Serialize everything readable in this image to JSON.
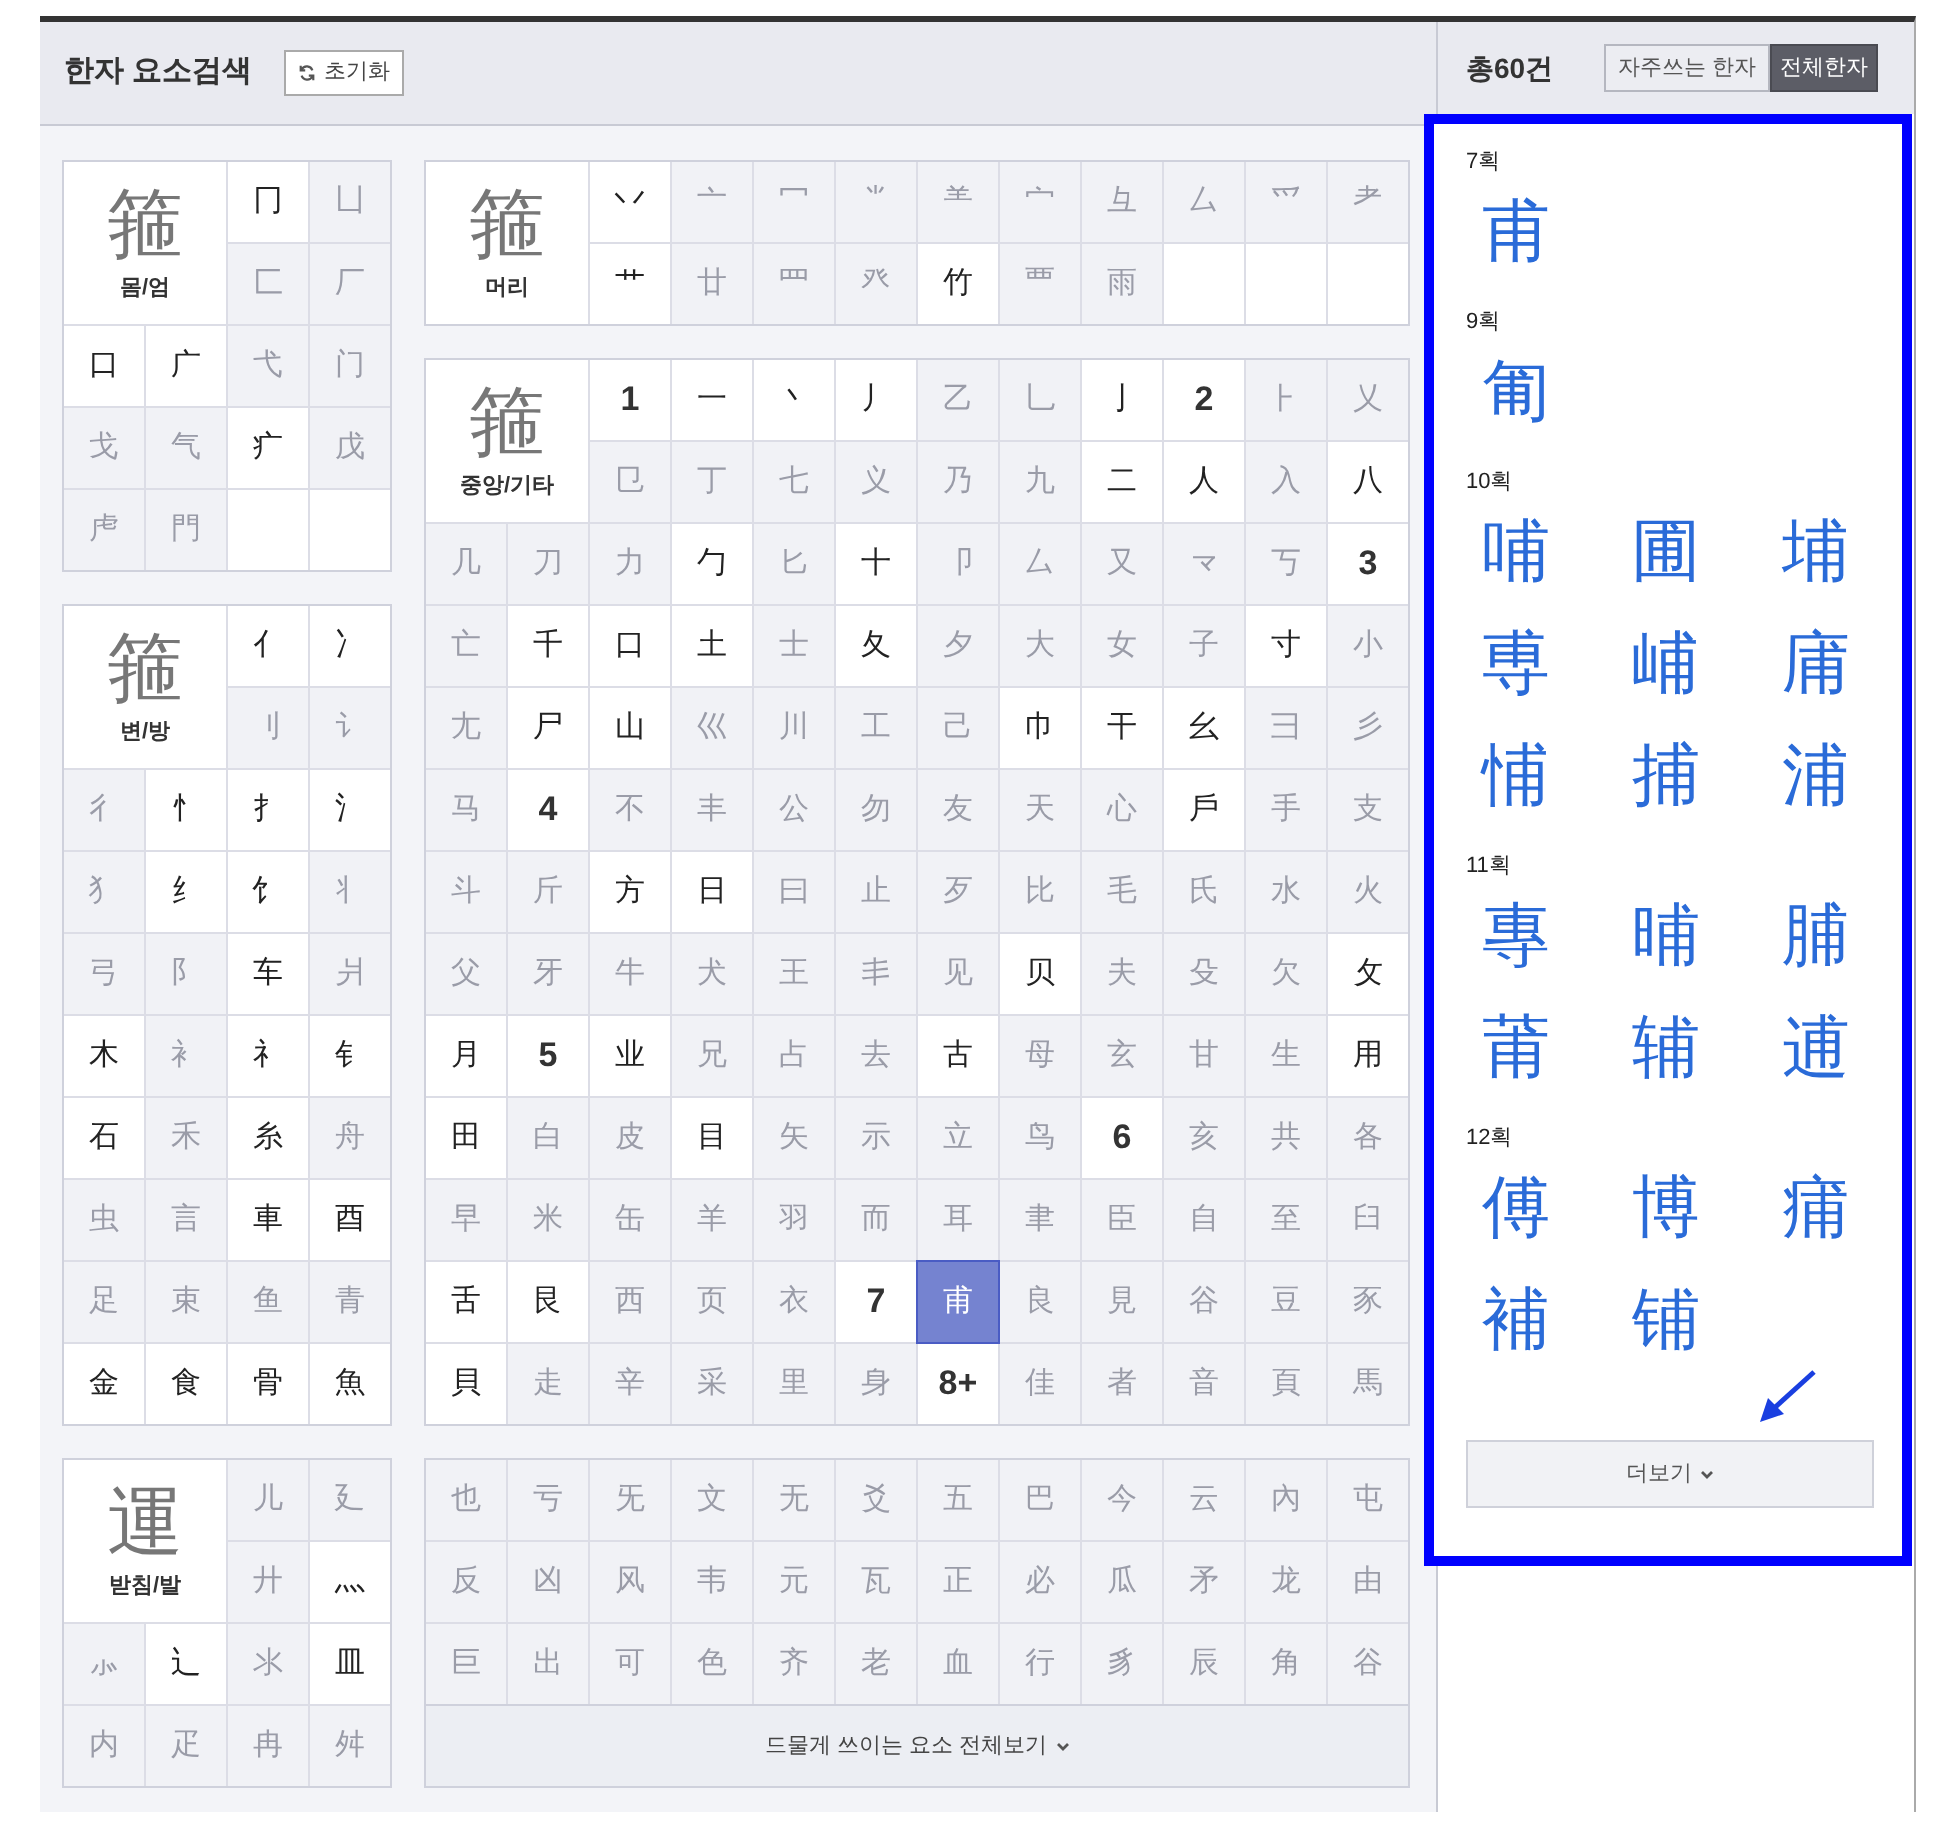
{
  "search_header": {
    "title": "한자 요소검색",
    "reset_button": "초기화"
  },
  "left_panels": [
    {
      "label": "몸/엄",
      "example": "箍",
      "cells": [
        {
          "kind": "element",
          "char": "冂",
          "enabled": true,
          "selected": false
        },
        {
          "kind": "element",
          "char": "凵",
          "enabled": false,
          "selected": false
        },
        {
          "kind": "element",
          "char": "匚",
          "enabled": false,
          "selected": false
        },
        {
          "kind": "element",
          "char": "厂",
          "enabled": false,
          "selected": false
        },
        {
          "kind": "element",
          "char": "口",
          "enabled": true,
          "selected": false
        },
        {
          "kind": "element",
          "char": "广",
          "enabled": true,
          "selected": false
        },
        {
          "kind": "element",
          "char": "弋",
          "enabled": false,
          "selected": false
        },
        {
          "kind": "element",
          "char": "门",
          "enabled": false,
          "selected": false
        },
        {
          "kind": "element",
          "char": "戈",
          "enabled": false,
          "selected": false
        },
        {
          "kind": "element",
          "char": "气",
          "enabled": false,
          "selected": false
        },
        {
          "kind": "element",
          "char": "疒",
          "enabled": true,
          "selected": false
        },
        {
          "kind": "element",
          "char": "戊",
          "enabled": false,
          "selected": false
        },
        {
          "kind": "element",
          "char": "虍",
          "enabled": false,
          "selected": false
        },
        {
          "kind": "element",
          "char": "門",
          "enabled": false,
          "selected": false
        }
      ]
    },
    {
      "label": "변/방",
      "example": "箍",
      "cells": [
        {
          "kind": "element",
          "char": "亻",
          "enabled": true,
          "selected": false
        },
        {
          "kind": "element",
          "char": "冫",
          "enabled": true,
          "selected": false
        },
        {
          "kind": "element",
          "char": "刂",
          "enabled": false,
          "selected": false
        },
        {
          "kind": "element",
          "char": "讠",
          "enabled": false,
          "selected": false
        },
        {
          "kind": "element",
          "char": "彳",
          "enabled": false,
          "selected": false
        },
        {
          "kind": "element",
          "char": "忄",
          "enabled": true,
          "selected": false
        },
        {
          "kind": "element",
          "char": "扌",
          "enabled": true,
          "selected": false
        },
        {
          "kind": "element",
          "char": "氵",
          "enabled": true,
          "selected": false
        },
        {
          "kind": "element",
          "char": "犭",
          "enabled": false,
          "selected": false
        },
        {
          "kind": "element",
          "char": "纟",
          "enabled": true,
          "selected": false
        },
        {
          "kind": "element",
          "char": "饣",
          "enabled": true,
          "selected": false
        },
        {
          "kind": "element",
          "char": "丬",
          "enabled": false,
          "selected": false
        },
        {
          "kind": "element",
          "char": "弓",
          "enabled": false,
          "selected": false
        },
        {
          "kind": "element",
          "char": "阝",
          "enabled": false,
          "selected": false
        },
        {
          "kind": "element",
          "char": "车",
          "enabled": true,
          "selected": false
        },
        {
          "kind": "element",
          "char": "爿",
          "enabled": false,
          "selected": false
        },
        {
          "kind": "element",
          "char": "木",
          "enabled": true,
          "selected": false
        },
        {
          "kind": "element",
          "char": "衤",
          "enabled": false,
          "selected": false
        },
        {
          "kind": "element",
          "char": "礻",
          "enabled": true,
          "selected": false
        },
        {
          "kind": "element",
          "char": "钅",
          "enabled": true,
          "selected": false
        },
        {
          "kind": "element",
          "char": "石",
          "enabled": true,
          "selected": false
        },
        {
          "kind": "element",
          "char": "禾",
          "enabled": false,
          "selected": false
        },
        {
          "kind": "element",
          "char": "糸",
          "enabled": true,
          "selected": false
        },
        {
          "kind": "element",
          "char": "舟",
          "enabled": false,
          "selected": false
        },
        {
          "kind": "element",
          "char": "虫",
          "enabled": false,
          "selected": false
        },
        {
          "kind": "element",
          "char": "言",
          "enabled": false,
          "selected": false
        },
        {
          "kind": "element",
          "char": "車",
          "enabled": true,
          "selected": false
        },
        {
          "kind": "element",
          "char": "酉",
          "enabled": true,
          "selected": false
        },
        {
          "kind": "element",
          "char": "足",
          "enabled": false,
          "selected": false
        },
        {
          "kind": "element",
          "char": "束",
          "enabled": false,
          "selected": false
        },
        {
          "kind": "element",
          "char": "鱼",
          "enabled": false,
          "selected": false
        },
        {
          "kind": "element",
          "char": "青",
          "enabled": false,
          "selected": false
        },
        {
          "kind": "element",
          "char": "金",
          "enabled": true,
          "selected": false
        },
        {
          "kind": "element",
          "char": "食",
          "enabled": true,
          "selected": false
        },
        {
          "kind": "element",
          "char": "骨",
          "enabled": true,
          "selected": false
        },
        {
          "kind": "element",
          "char": "魚",
          "enabled": true,
          "selected": false
        }
      ]
    },
    {
      "label": "받침/발",
      "example": "運",
      "cells": [
        {
          "kind": "element",
          "char": "儿",
          "enabled": false,
          "selected": false
        },
        {
          "kind": "element",
          "char": "廴",
          "enabled": false,
          "selected": false
        },
        {
          "kind": "element",
          "char": "廾",
          "enabled": false,
          "selected": false
        },
        {
          "kind": "element",
          "char": "灬",
          "enabled": true,
          "selected": false
        },
        {
          "kind": "element",
          "char": "⺗",
          "enabled": false,
          "selected": false
        },
        {
          "kind": "element",
          "char": "辶",
          "enabled": true,
          "selected": false
        },
        {
          "kind": "element",
          "char": "氺",
          "enabled": false,
          "selected": false
        },
        {
          "kind": "element",
          "char": "皿",
          "enabled": true,
          "selected": false
        },
        {
          "kind": "element",
          "char": "内",
          "enabled": false,
          "selected": false
        },
        {
          "kind": "element",
          "char": "疋",
          "enabled": false,
          "selected": false
        },
        {
          "kind": "element",
          "char": "冉",
          "enabled": false,
          "selected": false
        },
        {
          "kind": "element",
          "char": "舛",
          "enabled": false,
          "selected": false
        }
      ]
    }
  ],
  "middle_panels": [
    {
      "label": "머리",
      "example": "箍",
      "cells": [
        {
          "kind": "element",
          "char": "丷",
          "enabled": true,
          "selected": false
        },
        {
          "kind": "element",
          "char": "亠",
          "enabled": false,
          "selected": false
        },
        {
          "kind": "element",
          "char": "冖",
          "enabled": false,
          "selected": false
        },
        {
          "kind": "element",
          "char": "⺌",
          "enabled": false,
          "selected": false
        },
        {
          "kind": "element",
          "char": "⺷",
          "enabled": false,
          "selected": false
        },
        {
          "kind": "element",
          "char": "宀",
          "enabled": false,
          "selected": false
        },
        {
          "kind": "element",
          "char": "彑",
          "enabled": false,
          "selected": false
        },
        {
          "kind": "element",
          "char": "厶",
          "enabled": false,
          "selected": false
        },
        {
          "kind": "element",
          "char": "爫",
          "enabled": false,
          "selected": false
        },
        {
          "kind": "element",
          "char": "耂",
          "enabled": false,
          "selected": false
        },
        {
          "kind": "element",
          "char": "艹",
          "enabled": true,
          "selected": false
        },
        {
          "kind": "element",
          "char": "廿",
          "enabled": false,
          "selected": false
        },
        {
          "kind": "element",
          "char": "罒",
          "enabled": false,
          "selected": false
        },
        {
          "kind": "element",
          "char": "癶",
          "enabled": false,
          "selected": false
        },
        {
          "kind": "element",
          "char": "竹",
          "enabled": true,
          "selected": false
        },
        {
          "kind": "element",
          "char": "覀",
          "enabled": false,
          "selected": false
        },
        {
          "kind": "element",
          "char": "雨",
          "enabled": false,
          "selected": false
        }
      ]
    },
    {
      "label": "중앙/기타",
      "example": "箍",
      "cells": [
        {
          "kind": "stroke",
          "char": "1"
        },
        {
          "kind": "element",
          "char": "一",
          "enabled": true,
          "selected": false
        },
        {
          "kind": "element",
          "char": "丶",
          "enabled": true,
          "selected": false
        },
        {
          "kind": "element",
          "char": "丿",
          "enabled": true,
          "selected": false
        },
        {
          "kind": "element",
          "char": "乙",
          "enabled": false,
          "selected": false
        },
        {
          "kind": "element",
          "char": "乚",
          "enabled": false,
          "selected": false
        },
        {
          "kind": "element",
          "char": "亅",
          "enabled": true,
          "selected": false
        },
        {
          "kind": "stroke",
          "char": "2"
        },
        {
          "kind": "element",
          "char": "⺊",
          "enabled": false,
          "selected": false
        },
        {
          "kind": "element",
          "char": "乂",
          "enabled": false,
          "selected": false
        },
        {
          "kind": "element",
          "char": "㔾",
          "enabled": false,
          "selected": false
        },
        {
          "kind": "element",
          "char": "丁",
          "enabled": false,
          "selected": false
        },
        {
          "kind": "element",
          "char": "七",
          "enabled": false,
          "selected": false
        },
        {
          "kind": "element",
          "char": "义",
          "enabled": false,
          "selected": false
        },
        {
          "kind": "element",
          "char": "乃",
          "enabled": false,
          "selected": false
        },
        {
          "kind": "element",
          "char": "九",
          "enabled": false,
          "selected": false
        },
        {
          "kind": "element",
          "char": "二",
          "enabled": true,
          "selected": false
        },
        {
          "kind": "element",
          "char": "人",
          "enabled": true,
          "selected": false
        },
        {
          "kind": "element",
          "char": "入",
          "enabled": false,
          "selected": false
        },
        {
          "kind": "element",
          "char": "八",
          "enabled": true,
          "selected": false
        },
        {
          "kind": "element",
          "char": "几",
          "enabled": false,
          "selected": false
        },
        {
          "kind": "element",
          "char": "刀",
          "enabled": false,
          "selected": false
        },
        {
          "kind": "element",
          "char": "力",
          "enabled": false,
          "selected": false
        },
        {
          "kind": "element",
          "char": "勹",
          "enabled": true,
          "selected": false
        },
        {
          "kind": "element",
          "char": "匕",
          "enabled": false,
          "selected": false
        },
        {
          "kind": "element",
          "char": "十",
          "enabled": true,
          "selected": false
        },
        {
          "kind": "element",
          "char": "卩",
          "enabled": false,
          "selected": false
        },
        {
          "kind": "element",
          "char": "厶",
          "enabled": false,
          "selected": false
        },
        {
          "kind": "element",
          "char": "又",
          "enabled": false,
          "selected": false
        },
        {
          "kind": "element",
          "char": "龴",
          "enabled": false,
          "selected": false
        },
        {
          "kind": "element",
          "char": "丂",
          "enabled": false,
          "selected": false
        },
        {
          "kind": "stroke",
          "char": "3"
        },
        {
          "kind": "element",
          "char": "亡",
          "enabled": false,
          "selected": false
        },
        {
          "kind": "element",
          "char": "千",
          "enabled": true,
          "selected": false
        },
        {
          "kind": "element",
          "char": "口",
          "enabled": true,
          "selected": false
        },
        {
          "kind": "element",
          "char": "土",
          "enabled": true,
          "selected": false
        },
        {
          "kind": "element",
          "char": "士",
          "enabled": false,
          "selected": false
        },
        {
          "kind": "element",
          "char": "夂",
          "enabled": true,
          "selected": false
        },
        {
          "kind": "element",
          "char": "夕",
          "enabled": false,
          "selected": false
        },
        {
          "kind": "element",
          "char": "大",
          "enabled": false,
          "selected": false
        },
        {
          "kind": "element",
          "char": "女",
          "enabled": false,
          "selected": false
        },
        {
          "kind": "element",
          "char": "子",
          "enabled": false,
          "selected": false
        },
        {
          "kind": "element",
          "char": "寸",
          "enabled": true,
          "selected": false
        },
        {
          "kind": "element",
          "char": "小",
          "enabled": false,
          "selected": false
        },
        {
          "kind": "element",
          "char": "尢",
          "enabled": false,
          "selected": false
        },
        {
          "kind": "element",
          "char": "尸",
          "enabled": true,
          "selected": false
        },
        {
          "kind": "element",
          "char": "山",
          "enabled": true,
          "selected": false
        },
        {
          "kind": "element",
          "char": "巛",
          "enabled": false,
          "selected": false
        },
        {
          "kind": "element",
          "char": "川",
          "enabled": false,
          "selected": false
        },
        {
          "kind": "element",
          "char": "工",
          "enabled": false,
          "selected": false
        },
        {
          "kind": "element",
          "char": "己",
          "enabled": false,
          "selected": false
        },
        {
          "kind": "element",
          "char": "巾",
          "enabled": true,
          "selected": false
        },
        {
          "kind": "element",
          "char": "干",
          "enabled": true,
          "selected": false
        },
        {
          "kind": "element",
          "char": "幺",
          "enabled": true,
          "selected": false
        },
        {
          "kind": "element",
          "char": "彐",
          "enabled": false,
          "selected": false
        },
        {
          "kind": "element",
          "char": "彡",
          "enabled": false,
          "selected": false
        },
        {
          "kind": "element",
          "char": "马",
          "enabled": false,
          "selected": false
        },
        {
          "kind": "stroke",
          "char": "4"
        },
        {
          "kind": "element",
          "char": "不",
          "enabled": false,
          "selected": false
        },
        {
          "kind": "element",
          "char": "丰",
          "enabled": false,
          "selected": false
        },
        {
          "kind": "element",
          "char": "公",
          "enabled": false,
          "selected": false
        },
        {
          "kind": "element",
          "char": "勿",
          "enabled": false,
          "selected": false
        },
        {
          "kind": "element",
          "char": "友",
          "enabled": false,
          "selected": false
        },
        {
          "kind": "element",
          "char": "天",
          "enabled": false,
          "selected": false
        },
        {
          "kind": "element",
          "char": "心",
          "enabled": false,
          "selected": false
        },
        {
          "kind": "element",
          "char": "戶",
          "enabled": true,
          "selected": false
        },
        {
          "kind": "element",
          "char": "手",
          "enabled": false,
          "selected": false
        },
        {
          "kind": "element",
          "char": "支",
          "enabled": false,
          "selected": false
        },
        {
          "kind": "element",
          "char": "斗",
          "enabled": false,
          "selected": false
        },
        {
          "kind": "element",
          "char": "斤",
          "enabled": false,
          "selected": false
        },
        {
          "kind": "element",
          "char": "方",
          "enabled": true,
          "selected": false
        },
        {
          "kind": "element",
          "char": "日",
          "enabled": true,
          "selected": false
        },
        {
          "kind": "element",
          "char": "曰",
          "enabled": false,
          "selected": false
        },
        {
          "kind": "element",
          "char": "止",
          "enabled": false,
          "selected": false
        },
        {
          "kind": "element",
          "char": "歹",
          "enabled": false,
          "selected": false
        },
        {
          "kind": "element",
          "char": "比",
          "enabled": false,
          "selected": false
        },
        {
          "kind": "element",
          "char": "毛",
          "enabled": false,
          "selected": false
        },
        {
          "kind": "element",
          "char": "氏",
          "enabled": false,
          "selected": false
        },
        {
          "kind": "element",
          "char": "水",
          "enabled": false,
          "selected": false
        },
        {
          "kind": "element",
          "char": "火",
          "enabled": false,
          "selected": false
        },
        {
          "kind": "element",
          "char": "父",
          "enabled": false,
          "selected": false
        },
        {
          "kind": "element",
          "char": "牙",
          "enabled": false,
          "selected": false
        },
        {
          "kind": "element",
          "char": "牛",
          "enabled": false,
          "selected": false
        },
        {
          "kind": "element",
          "char": "犬",
          "enabled": false,
          "selected": false
        },
        {
          "kind": "element",
          "char": "王",
          "enabled": false,
          "selected": false
        },
        {
          "kind": "element",
          "char": "丯",
          "enabled": false,
          "selected": false
        },
        {
          "kind": "element",
          "char": "见",
          "enabled": false,
          "selected": false
        },
        {
          "kind": "element",
          "char": "贝",
          "enabled": true,
          "selected": false
        },
        {
          "kind": "element",
          "char": "夫",
          "enabled": false,
          "selected": false
        },
        {
          "kind": "element",
          "char": "殳",
          "enabled": false,
          "selected": false
        },
        {
          "kind": "element",
          "char": "欠",
          "enabled": false,
          "selected": false
        },
        {
          "kind": "element",
          "char": "攵",
          "enabled": true,
          "selected": false
        },
        {
          "kind": "element",
          "char": "月",
          "enabled": true,
          "selected": false
        },
        {
          "kind": "stroke",
          "char": "5"
        },
        {
          "kind": "element",
          "char": "业",
          "enabled": true,
          "selected": false
        },
        {
          "kind": "element",
          "char": "兄",
          "enabled": false,
          "selected": false
        },
        {
          "kind": "element",
          "char": "占",
          "enabled": false,
          "selected": false
        },
        {
          "kind": "element",
          "char": "去",
          "enabled": false,
          "selected": false
        },
        {
          "kind": "element",
          "char": "古",
          "enabled": true,
          "selected": false
        },
        {
          "kind": "element",
          "char": "母",
          "enabled": false,
          "selected": false
        },
        {
          "kind": "element",
          "char": "玄",
          "enabled": false,
          "selected": false
        },
        {
          "kind": "element",
          "char": "甘",
          "enabled": false,
          "selected": false
        },
        {
          "kind": "element",
          "char": "生",
          "enabled": false,
          "selected": false
        },
        {
          "kind": "element",
          "char": "用",
          "enabled": true,
          "selected": false
        },
        {
          "kind": "element",
          "char": "田",
          "enabled": true,
          "selected": false
        },
        {
          "kind": "element",
          "char": "白",
          "enabled": false,
          "selected": false
        },
        {
          "kind": "element",
          "char": "皮",
          "enabled": false,
          "selected": false
        },
        {
          "kind": "element",
          "char": "目",
          "enabled": true,
          "selected": false
        },
        {
          "kind": "element",
          "char": "矢",
          "enabled": false,
          "selected": false
        },
        {
          "kind": "element",
          "char": "示",
          "enabled": false,
          "selected": false
        },
        {
          "kind": "element",
          "char": "立",
          "enabled": false,
          "selected": false
        },
        {
          "kind": "element",
          "char": "鸟",
          "enabled": false,
          "selected": false
        },
        {
          "kind": "stroke",
          "char": "6"
        },
        {
          "kind": "element",
          "char": "亥",
          "enabled": false,
          "selected": false
        },
        {
          "kind": "element",
          "char": "共",
          "enabled": false,
          "selected": false
        },
        {
          "kind": "element",
          "char": "各",
          "enabled": false,
          "selected": false
        },
        {
          "kind": "element",
          "char": "早",
          "enabled": false,
          "selected": false
        },
        {
          "kind": "element",
          "char": "米",
          "enabled": false,
          "selected": false
        },
        {
          "kind": "element",
          "char": "缶",
          "enabled": false,
          "selected": false
        },
        {
          "kind": "element",
          "char": "羊",
          "enabled": false,
          "selected": false
        },
        {
          "kind": "element",
          "char": "羽",
          "enabled": false,
          "selected": false
        },
        {
          "kind": "element",
          "char": "而",
          "enabled": false,
          "selected": false
        },
        {
          "kind": "element",
          "char": "耳",
          "enabled": false,
          "selected": false
        },
        {
          "kind": "element",
          "char": "聿",
          "enabled": false,
          "selected": false
        },
        {
          "kind": "element",
          "char": "臣",
          "enabled": false,
          "selected": false
        },
        {
          "kind": "element",
          "char": "自",
          "enabled": false,
          "selected": false
        },
        {
          "kind": "element",
          "char": "至",
          "enabled": false,
          "selected": false
        },
        {
          "kind": "element",
          "char": "臼",
          "enabled": false,
          "selected": false
        },
        {
          "kind": "element",
          "char": "舌",
          "enabled": true,
          "selected": false
        },
        {
          "kind": "element",
          "char": "艮",
          "enabled": true,
          "selected": false
        },
        {
          "kind": "element",
          "char": "西",
          "enabled": false,
          "selected": false
        },
        {
          "kind": "element",
          "char": "页",
          "enabled": false,
          "selected": false
        },
        {
          "kind": "element",
          "char": "衣",
          "enabled": false,
          "selected": false
        },
        {
          "kind": "stroke",
          "char": "7"
        },
        {
          "kind": "element",
          "char": "甫",
          "enabled": true,
          "selected": true
        },
        {
          "kind": "element",
          "char": "良",
          "enabled": false,
          "selected": false
        },
        {
          "kind": "element",
          "char": "見",
          "enabled": false,
          "selected": false
        },
        {
          "kind": "element",
          "char": "谷",
          "enabled": false,
          "selected": false
        },
        {
          "kind": "element",
          "char": "豆",
          "enabled": false,
          "selected": false
        },
        {
          "kind": "element",
          "char": "豕",
          "enabled": false,
          "selected": false
        },
        {
          "kind": "element",
          "char": "貝",
          "enabled": true,
          "selected": false
        },
        {
          "kind": "element",
          "char": "走",
          "enabled": false,
          "selected": false
        },
        {
          "kind": "element",
          "char": "辛",
          "enabled": false,
          "selected": false
        },
        {
          "kind": "element",
          "char": "采",
          "enabled": false,
          "selected": false
        },
        {
          "kind": "element",
          "char": "里",
          "enabled": false,
          "selected": false
        },
        {
          "kind": "element",
          "char": "身",
          "enabled": false,
          "selected": false
        },
        {
          "kind": "stroke",
          "char": "8+"
        },
        {
          "kind": "element",
          "char": "佳",
          "enabled": false,
          "selected": false
        },
        {
          "kind": "element",
          "char": "者",
          "enabled": false,
          "selected": false
        },
        {
          "kind": "element",
          "char": "音",
          "enabled": false,
          "selected": false
        },
        {
          "kind": "element",
          "char": "頁",
          "enabled": false,
          "selected": false
        },
        {
          "kind": "element",
          "char": "馬",
          "enabled": false,
          "selected": false
        }
      ]
    },
    {
      "more_button": "드물게 쓰이는 요소 전체보기",
      "cells": [
        {
          "kind": "element",
          "char": "也",
          "enabled": false,
          "selected": false
        },
        {
          "kind": "element",
          "char": "亏",
          "enabled": false,
          "selected": false
        },
        {
          "kind": "element",
          "char": "旡",
          "enabled": false,
          "selected": false
        },
        {
          "kind": "element",
          "char": "文",
          "enabled": false,
          "selected": false
        },
        {
          "kind": "element",
          "char": "无",
          "enabled": false,
          "selected": false
        },
        {
          "kind": "element",
          "char": "爻",
          "enabled": false,
          "selected": false
        },
        {
          "kind": "element",
          "char": "五",
          "enabled": false,
          "selected": false
        },
        {
          "kind": "element",
          "char": "巴",
          "enabled": false,
          "selected": false
        },
        {
          "kind": "element",
          "char": "今",
          "enabled": false,
          "selected": false
        },
        {
          "kind": "element",
          "char": "云",
          "enabled": false,
          "selected": false
        },
        {
          "kind": "element",
          "char": "內",
          "enabled": false,
          "selected": false
        },
        {
          "kind": "element",
          "char": "屯",
          "enabled": false,
          "selected": false
        },
        {
          "kind": "element",
          "char": "反",
          "enabled": false,
          "selected": false
        },
        {
          "kind": "element",
          "char": "凶",
          "enabled": false,
          "selected": false
        },
        {
          "kind": "element",
          "char": "风",
          "enabled": false,
          "selected": false
        },
        {
          "kind": "element",
          "char": "韦",
          "enabled": false,
          "selected": false
        },
        {
          "kind": "element",
          "char": "元",
          "enabled": false,
          "selected": false
        },
        {
          "kind": "element",
          "char": "瓦",
          "enabled": false,
          "selected": false
        },
        {
          "kind": "element",
          "char": "正",
          "enabled": false,
          "selected": false
        },
        {
          "kind": "element",
          "char": "必",
          "enabled": false,
          "selected": false
        },
        {
          "kind": "element",
          "char": "瓜",
          "enabled": false,
          "selected": false
        },
        {
          "kind": "element",
          "char": "矛",
          "enabled": false,
          "selected": false
        },
        {
          "kind": "element",
          "char": "龙",
          "enabled": false,
          "selected": false
        },
        {
          "kind": "element",
          "char": "由",
          "enabled": false,
          "selected": false
        },
        {
          "kind": "element",
          "char": "巨",
          "enabled": false,
          "selected": false
        },
        {
          "kind": "element",
          "char": "出",
          "enabled": false,
          "selected": false
        },
        {
          "kind": "element",
          "char": "可",
          "enabled": false,
          "selected": false
        },
        {
          "kind": "element",
          "char": "色",
          "enabled": false,
          "selected": false
        },
        {
          "kind": "element",
          "char": "齐",
          "enabled": false,
          "selected": false
        },
        {
          "kind": "element",
          "char": "老",
          "enabled": false,
          "selected": false
        },
        {
          "kind": "element",
          "char": "血",
          "enabled": false,
          "selected": false
        },
        {
          "kind": "element",
          "char": "行",
          "enabled": false,
          "selected": false
        },
        {
          "kind": "element",
          "char": "豸",
          "enabled": false,
          "selected": false
        },
        {
          "kind": "element",
          "char": "辰",
          "enabled": false,
          "selected": false
        },
        {
          "kind": "element",
          "char": "角",
          "enabled": false,
          "selected": false
        },
        {
          "kind": "element",
          "char": "谷",
          "enabled": false,
          "selected": false
        }
      ]
    }
  ],
  "results": {
    "total": "총60건",
    "filters": [
      {
        "label": "자주쓰는 한자",
        "selected": false
      },
      {
        "label": "전체한자",
        "selected": true
      }
    ],
    "groups": [
      {
        "label": "7획",
        "chars": [
          "甫"
        ]
      },
      {
        "label": "9획",
        "chars": [
          "匍"
        ]
      },
      {
        "label": "10획",
        "chars": [
          "哺",
          "圃",
          "埔",
          "尃",
          "峬",
          "庯",
          "悑",
          "捕",
          "浦"
        ]
      },
      {
        "label": "11획",
        "chars": [
          "專",
          "晡",
          "脯",
          "莆",
          "辅",
          "逋"
        ]
      },
      {
        "label": "12획",
        "chars": [
          "傅",
          "博",
          "痡",
          "補",
          "铺"
        ]
      }
    ],
    "more_button": "더보기"
  }
}
